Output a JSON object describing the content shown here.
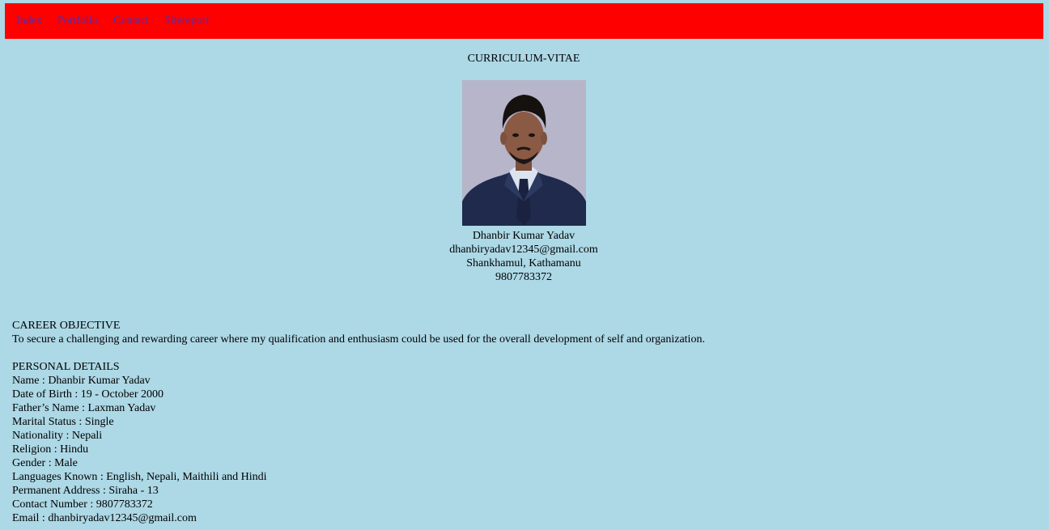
{
  "nav": {
    "items": [
      "Index",
      "Portfolio",
      "Contact",
      "Sitereport"
    ]
  },
  "cv": {
    "heading": "CURRICULUM-VITAE",
    "photo_alt": "profile photo",
    "name": "Dhanbir Kumar Yadav",
    "email": "dhanbiryadav12345@gmail.com",
    "address": "Shankhamul, Kathamanu",
    "phone": "9807783372"
  },
  "career": {
    "title": "CAREER OBJECTIVE",
    "text": "To secure a challenging and rewarding career where my qualification and enthusiasm could be used for the overall development of self and organization."
  },
  "personal": {
    "title": "PERSONAL DETAILS",
    "items": [
      "Name : Dhanbir Kumar Yadav",
      "Date of Birth : 19 - October 2000",
      "Father’s Name : Laxman Yadav",
      "Marital Status : Single",
      "Nationality : Nepali",
      "Religion : Hindu",
      "Gender : Male",
      "Languages Known : English, Nepali, Maithili and Hindi",
      "Permanent Address : Siraha - 13",
      "Contact Number : 9807783372",
      "Email : dhanbiryadav12345@gmail.com"
    ]
  },
  "colors": {
    "background": "#add8e6",
    "navbar": "#ff0000",
    "nav_link": "#5b2aa0"
  }
}
